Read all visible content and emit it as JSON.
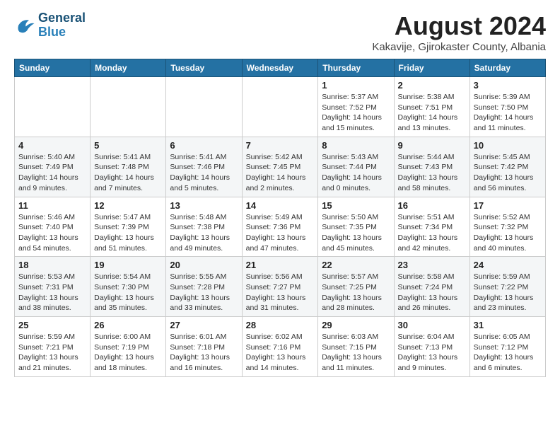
{
  "header": {
    "logo_line1": "General",
    "logo_line2": "Blue",
    "month": "August 2024",
    "location": "Kakavije, Gjirokaster County, Albania"
  },
  "weekdays": [
    "Sunday",
    "Monday",
    "Tuesday",
    "Wednesday",
    "Thursday",
    "Friday",
    "Saturday"
  ],
  "weeks": [
    [
      {
        "day": "",
        "info": ""
      },
      {
        "day": "",
        "info": ""
      },
      {
        "day": "",
        "info": ""
      },
      {
        "day": "",
        "info": ""
      },
      {
        "day": "1",
        "info": "Sunrise: 5:37 AM\nSunset: 7:52 PM\nDaylight: 14 hours\nand 15 minutes."
      },
      {
        "day": "2",
        "info": "Sunrise: 5:38 AM\nSunset: 7:51 PM\nDaylight: 14 hours\nand 13 minutes."
      },
      {
        "day": "3",
        "info": "Sunrise: 5:39 AM\nSunset: 7:50 PM\nDaylight: 14 hours\nand 11 minutes."
      }
    ],
    [
      {
        "day": "4",
        "info": "Sunrise: 5:40 AM\nSunset: 7:49 PM\nDaylight: 14 hours\nand 9 minutes."
      },
      {
        "day": "5",
        "info": "Sunrise: 5:41 AM\nSunset: 7:48 PM\nDaylight: 14 hours\nand 7 minutes."
      },
      {
        "day": "6",
        "info": "Sunrise: 5:41 AM\nSunset: 7:46 PM\nDaylight: 14 hours\nand 5 minutes."
      },
      {
        "day": "7",
        "info": "Sunrise: 5:42 AM\nSunset: 7:45 PM\nDaylight: 14 hours\nand 2 minutes."
      },
      {
        "day": "8",
        "info": "Sunrise: 5:43 AM\nSunset: 7:44 PM\nDaylight: 14 hours\nand 0 minutes."
      },
      {
        "day": "9",
        "info": "Sunrise: 5:44 AM\nSunset: 7:43 PM\nDaylight: 13 hours\nand 58 minutes."
      },
      {
        "day": "10",
        "info": "Sunrise: 5:45 AM\nSunset: 7:42 PM\nDaylight: 13 hours\nand 56 minutes."
      }
    ],
    [
      {
        "day": "11",
        "info": "Sunrise: 5:46 AM\nSunset: 7:40 PM\nDaylight: 13 hours\nand 54 minutes."
      },
      {
        "day": "12",
        "info": "Sunrise: 5:47 AM\nSunset: 7:39 PM\nDaylight: 13 hours\nand 51 minutes."
      },
      {
        "day": "13",
        "info": "Sunrise: 5:48 AM\nSunset: 7:38 PM\nDaylight: 13 hours\nand 49 minutes."
      },
      {
        "day": "14",
        "info": "Sunrise: 5:49 AM\nSunset: 7:36 PM\nDaylight: 13 hours\nand 47 minutes."
      },
      {
        "day": "15",
        "info": "Sunrise: 5:50 AM\nSunset: 7:35 PM\nDaylight: 13 hours\nand 45 minutes."
      },
      {
        "day": "16",
        "info": "Sunrise: 5:51 AM\nSunset: 7:34 PM\nDaylight: 13 hours\nand 42 minutes."
      },
      {
        "day": "17",
        "info": "Sunrise: 5:52 AM\nSunset: 7:32 PM\nDaylight: 13 hours\nand 40 minutes."
      }
    ],
    [
      {
        "day": "18",
        "info": "Sunrise: 5:53 AM\nSunset: 7:31 PM\nDaylight: 13 hours\nand 38 minutes."
      },
      {
        "day": "19",
        "info": "Sunrise: 5:54 AM\nSunset: 7:30 PM\nDaylight: 13 hours\nand 35 minutes."
      },
      {
        "day": "20",
        "info": "Sunrise: 5:55 AM\nSunset: 7:28 PM\nDaylight: 13 hours\nand 33 minutes."
      },
      {
        "day": "21",
        "info": "Sunrise: 5:56 AM\nSunset: 7:27 PM\nDaylight: 13 hours\nand 31 minutes."
      },
      {
        "day": "22",
        "info": "Sunrise: 5:57 AM\nSunset: 7:25 PM\nDaylight: 13 hours\nand 28 minutes."
      },
      {
        "day": "23",
        "info": "Sunrise: 5:58 AM\nSunset: 7:24 PM\nDaylight: 13 hours\nand 26 minutes."
      },
      {
        "day": "24",
        "info": "Sunrise: 5:59 AM\nSunset: 7:22 PM\nDaylight: 13 hours\nand 23 minutes."
      }
    ],
    [
      {
        "day": "25",
        "info": "Sunrise: 5:59 AM\nSunset: 7:21 PM\nDaylight: 13 hours\nand 21 minutes."
      },
      {
        "day": "26",
        "info": "Sunrise: 6:00 AM\nSunset: 7:19 PM\nDaylight: 13 hours\nand 18 minutes."
      },
      {
        "day": "27",
        "info": "Sunrise: 6:01 AM\nSunset: 7:18 PM\nDaylight: 13 hours\nand 16 minutes."
      },
      {
        "day": "28",
        "info": "Sunrise: 6:02 AM\nSunset: 7:16 PM\nDaylight: 13 hours\nand 14 minutes."
      },
      {
        "day": "29",
        "info": "Sunrise: 6:03 AM\nSunset: 7:15 PM\nDaylight: 13 hours\nand 11 minutes."
      },
      {
        "day": "30",
        "info": "Sunrise: 6:04 AM\nSunset: 7:13 PM\nDaylight: 13 hours\nand 9 minutes."
      },
      {
        "day": "31",
        "info": "Sunrise: 6:05 AM\nSunset: 7:12 PM\nDaylight: 13 hours\nand 6 minutes."
      }
    ]
  ]
}
